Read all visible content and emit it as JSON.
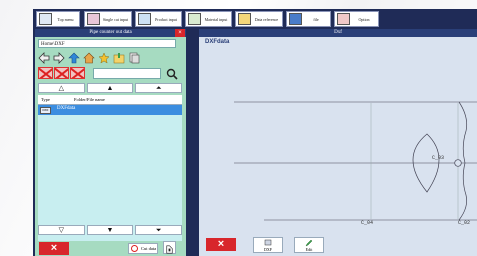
{
  "toolbar": {
    "items": [
      {
        "label": "Top menu",
        "icon": "document-icon"
      },
      {
        "label": "Single cut input",
        "icon": "cut-icon"
      },
      {
        "label": "Product input",
        "icon": "product-icon"
      },
      {
        "label": "Material input",
        "icon": "material-icon"
      },
      {
        "label": "Data reference",
        "icon": "folder-icon"
      },
      {
        "label": "file",
        "icon": "monitor-icon"
      },
      {
        "label": "Option",
        "icon": "option-icon"
      }
    ]
  },
  "dialog": {
    "title": "Pipe counter out data",
    "close": "×",
    "home_path": "Home\\DXF",
    "list": {
      "col_type": "Type",
      "col_name": "Folder/File name",
      "rows": [
        {
          "type_icon": "DXF",
          "name": "DXFdata"
        }
      ]
    },
    "nav_top": [
      "△",
      "▲",
      "⏶"
    ],
    "nav_bottom": [
      "▽",
      "▼",
      "⏷"
    ],
    "cancel_label": "×",
    "confirm_label": "Cut data"
  },
  "dxf": {
    "title": "Dxf",
    "name": "DXFdata",
    "labels": {
      "c03": "C_03",
      "c04": "C_04",
      "c02": "C_02"
    },
    "cancel_label": "×",
    "btn1_label": "DXF",
    "btn2_label": "Edit"
  },
  "colors": {
    "frame": "#1f2b57",
    "dialog_bg": "#a6dbc1",
    "title_bar": "#2a3f78",
    "selected_row": "#3b8de0",
    "cancel": "#d8262b",
    "canvas_bg": "#d9e2ef"
  }
}
